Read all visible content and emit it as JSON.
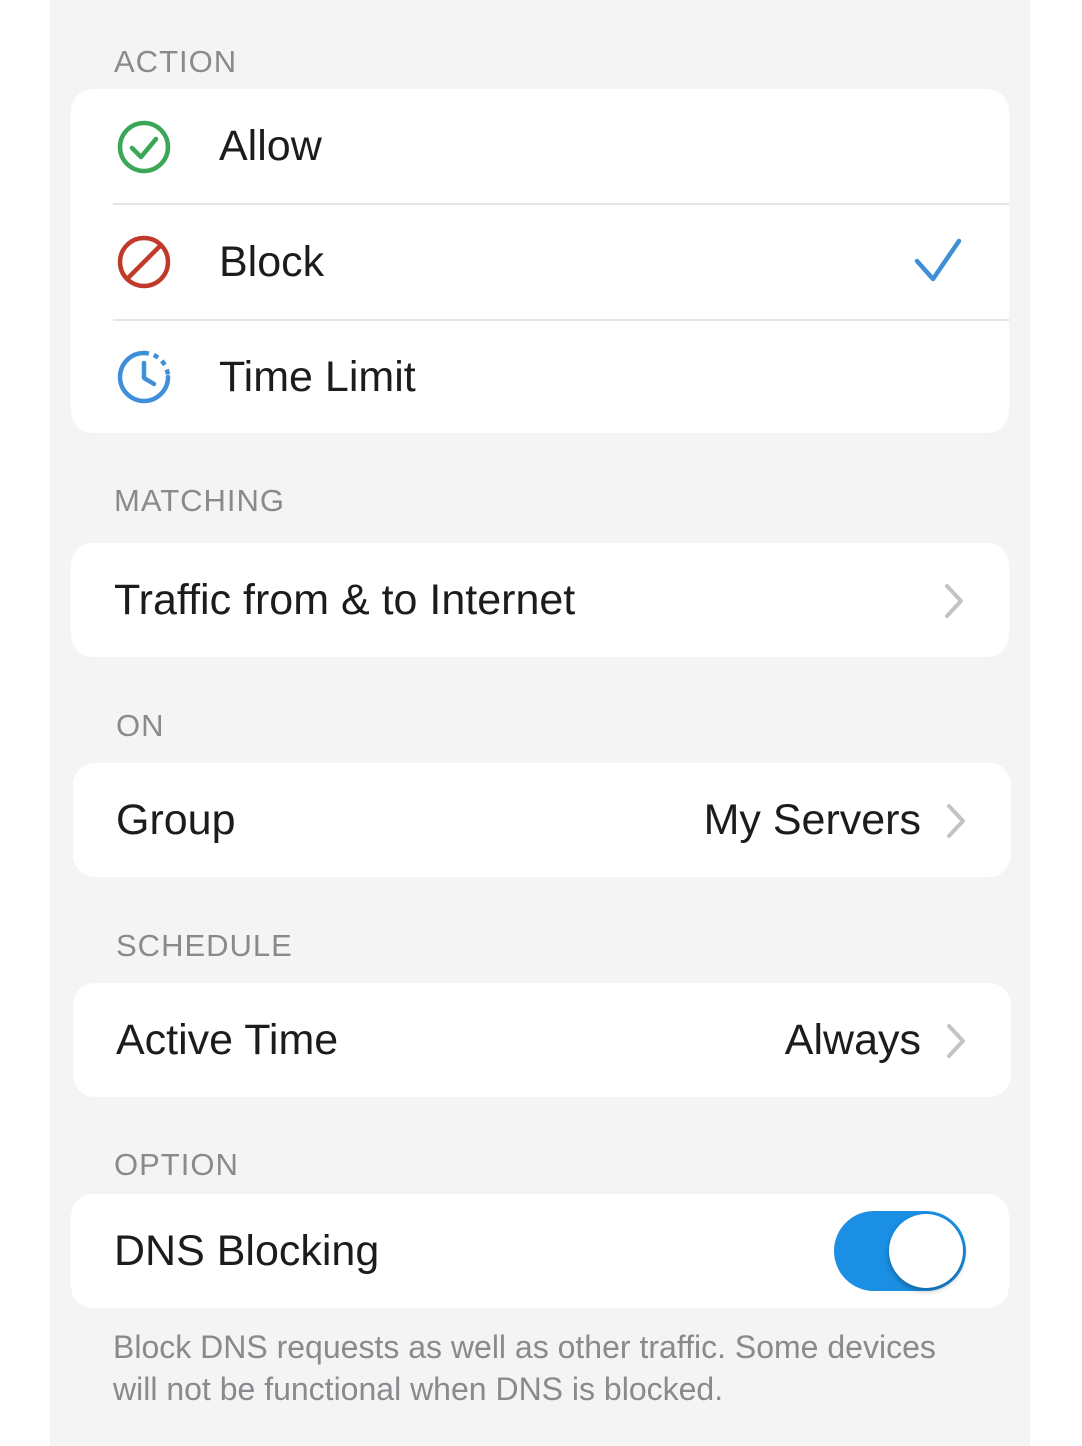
{
  "sections": {
    "action": {
      "header": "ACTION",
      "items": [
        {
          "label": "Allow",
          "icon": "allow-check-circle-icon",
          "color": "#3aa757",
          "selected": false
        },
        {
          "label": "Block",
          "icon": "block-circle-icon",
          "color": "#c0392b",
          "selected": true
        },
        {
          "label": "Time Limit",
          "icon": "time-limit-clock-icon",
          "color": "#3f8fd8",
          "selected": false
        }
      ],
      "checkmark_color": "#3f8fd8"
    },
    "matching": {
      "header": "MATCHING",
      "label": "Traffic from & to Internet"
    },
    "on": {
      "header": "ON",
      "label": "Group",
      "value": "My Servers"
    },
    "schedule": {
      "header": "SCHEDULE",
      "label": "Active Time",
      "value": "Always"
    },
    "option": {
      "header": "OPTION",
      "label": "DNS Blocking",
      "enabled": true,
      "toggle_color": "#1a8fe3",
      "footnote": "Block DNS requests as well as other traffic. Some devices will not be functional when DNS is blocked."
    }
  }
}
